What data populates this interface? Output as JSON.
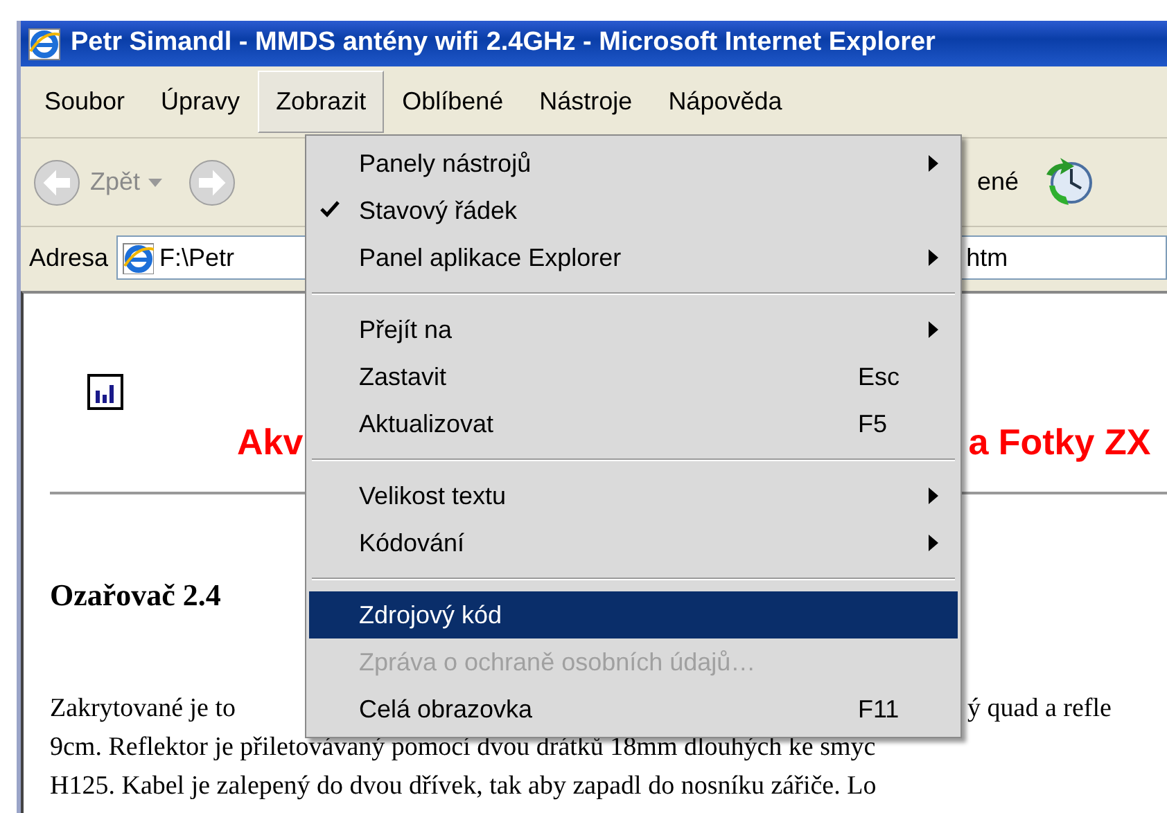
{
  "window": {
    "title": "Petr Simandl - MMDS antény wifi 2.4GHz - Microsoft Internet Explorer"
  },
  "menu_bar": [
    {
      "label": "Soubor",
      "selected": false
    },
    {
      "label": "Úpravy",
      "selected": false
    },
    {
      "label": "Zobrazit",
      "selected": true
    },
    {
      "label": "Oblíbené",
      "selected": false
    },
    {
      "label": "Nástroje",
      "selected": false
    },
    {
      "label": "Nápověda",
      "selected": false
    }
  ],
  "toolbar": {
    "back": {
      "label": "Zpět",
      "disabled": true
    },
    "favorites_fragment": "ené"
  },
  "address_bar": {
    "label": "Adresa",
    "value_left": "F:\\Petr",
    "value_right": "htm"
  },
  "dropdown": [
    {
      "kind": "item",
      "label": "Panely nástrojů",
      "checked": false,
      "submenu": true,
      "selected": false,
      "disabled": false
    },
    {
      "kind": "item",
      "label": "Stavový řádek",
      "checked": true,
      "submenu": false,
      "selected": false,
      "disabled": false
    },
    {
      "kind": "item",
      "label": "Panel aplikace Explorer",
      "checked": false,
      "submenu": true,
      "selected": false,
      "disabled": false
    },
    {
      "kind": "separator"
    },
    {
      "kind": "item",
      "label": "Přejít na",
      "checked": false,
      "submenu": true,
      "selected": false,
      "disabled": false
    },
    {
      "kind": "item",
      "label": "Zastavit",
      "shortcut": "Esc",
      "checked": false,
      "submenu": false,
      "selected": false,
      "disabled": false
    },
    {
      "kind": "item",
      "label": "Aktualizovat",
      "shortcut": "F5",
      "checked": false,
      "submenu": false,
      "selected": false,
      "disabled": false
    },
    {
      "kind": "separator"
    },
    {
      "kind": "item",
      "label": "Velikost textu",
      "checked": false,
      "submenu": true,
      "selected": false,
      "disabled": false
    },
    {
      "kind": "item",
      "label": "Kódování",
      "checked": false,
      "submenu": true,
      "selected": false,
      "disabled": false
    },
    {
      "kind": "separator"
    },
    {
      "kind": "item",
      "label": "Zdrojový kód",
      "checked": false,
      "submenu": false,
      "selected": true,
      "disabled": false
    },
    {
      "kind": "item",
      "label": "Zpráva o ochraně osobních údajů…",
      "checked": false,
      "submenu": false,
      "selected": false,
      "disabled": true
    },
    {
      "kind": "item",
      "label": "Celá obrazovka",
      "shortcut": "F11",
      "checked": false,
      "submenu": false,
      "selected": false,
      "disabled": false
    }
  ],
  "page": {
    "banner_left": "Akv",
    "banner_right": "a Fotky ZX",
    "heading": "Ozařovač 2.4",
    "lines": [
      {
        "left": "Zakrytované je to",
        "right": "ý quad a refle"
      },
      {
        "left": "9cm. Reflektor je přiletovávaný pomocí dvou drátků 18mm dlouhých ke smyc"
      },
      {
        "left": "H125. Kabel je zalepený do dvou dřívek, tak aby zapadl do nosníku zářiče. Lo"
      }
    ]
  }
}
